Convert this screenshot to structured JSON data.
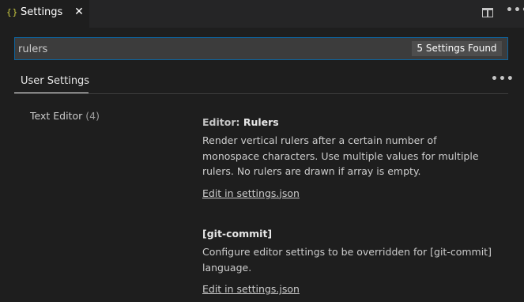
{
  "tab": {
    "icon": "{}",
    "label": "Settings",
    "close": "✕"
  },
  "toolbar": {
    "split_icon": "split-editor-icon",
    "more": "•••"
  },
  "search": {
    "value": "rulers",
    "placeholder": "",
    "count": "5 Settings Found"
  },
  "settings_tabs": {
    "active": "User Settings",
    "more": "•••"
  },
  "toc": {
    "items": [
      {
        "label": "Text Editor",
        "count": "(4)"
      }
    ]
  },
  "settings": [
    {
      "category": "Editor: ",
      "name": "Rulers",
      "description": "Render vertical rulers after a certain number of monospace characters. Use multiple values for multiple rulers. No rulers are drawn if array is empty.",
      "link": "Edit in settings.json"
    },
    {
      "category": "",
      "name": "[git-commit]",
      "description": "Configure editor settings to be overridden for [git-commit] language.",
      "link": "Edit in settings.json"
    }
  ]
}
